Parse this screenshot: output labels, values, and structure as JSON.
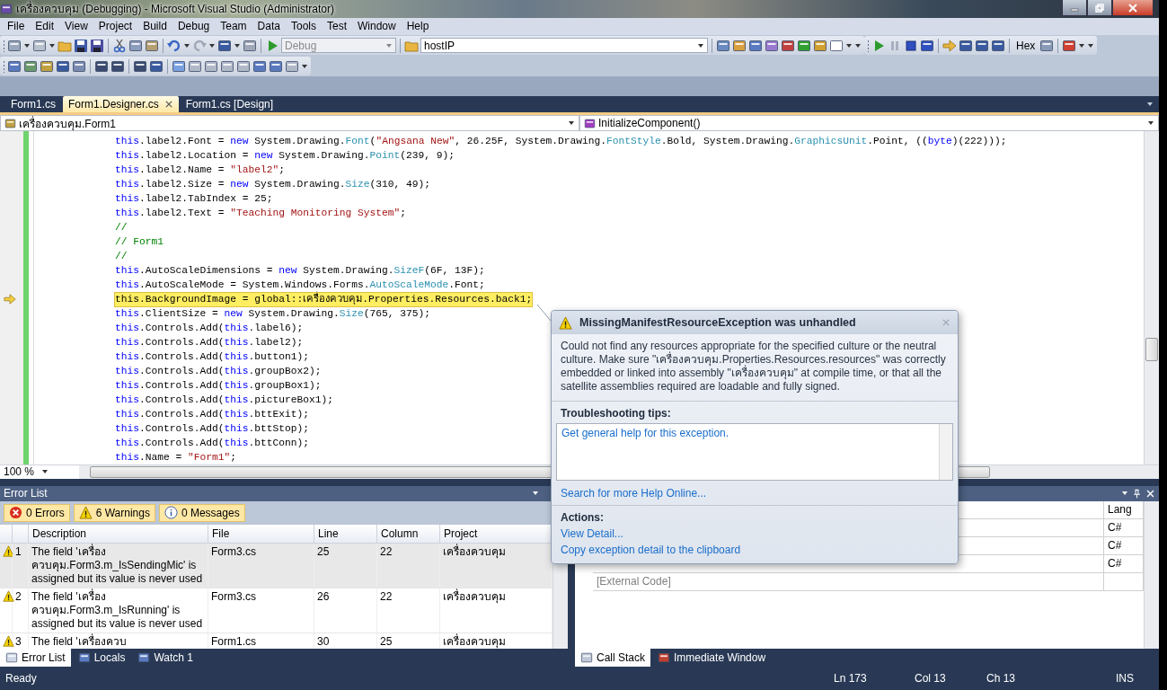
{
  "window": {
    "title": "เครื่องควบคุม (Debugging) - Microsoft Visual Studio (Administrator)"
  },
  "menu": [
    "File",
    "Edit",
    "View",
    "Project",
    "Build",
    "Debug",
    "Team",
    "Data",
    "Tools",
    "Test",
    "Window",
    "Help"
  ],
  "toolbar": {
    "configuration": {
      "value": "Debug",
      "disabled": true
    },
    "find": {
      "value": "hostIP"
    },
    "hex_button": {
      "label": "Hex"
    }
  },
  "document_tabs": [
    {
      "label": "Form1.cs",
      "selected": false,
      "closable": false
    },
    {
      "label": "Form1.Designer.cs",
      "selected": true,
      "closable": true
    },
    {
      "label": "Form1.cs [Design]",
      "selected": false,
      "closable": false
    }
  ],
  "navigation": {
    "type_dropdown": "เครื่องควบคุม.Form1",
    "member_dropdown": "InitializeComponent()"
  },
  "editor": {
    "zoom": "100 %",
    "lines": [
      {
        "current": false,
        "segments": [
          {
            "kind": "keyword",
            "text": "this"
          },
          {
            "kind": "plain",
            "text": ".label2.Font = "
          },
          {
            "kind": "keyword",
            "text": "new"
          },
          {
            "kind": "plain",
            "text": " System.Drawing."
          },
          {
            "kind": "type",
            "text": "Font"
          },
          {
            "kind": "plain",
            "text": "("
          },
          {
            "kind": "string",
            "text": "\"Angsana New\""
          },
          {
            "kind": "plain",
            "text": ", 26.25F, System.Drawing."
          },
          {
            "kind": "type",
            "text": "FontStyle"
          },
          {
            "kind": "plain",
            "text": ".Bold, System.Drawing."
          },
          {
            "kind": "type",
            "text": "GraphicsUnit"
          },
          {
            "kind": "plain",
            "text": ".Point, (("
          },
          {
            "kind": "keyword",
            "text": "byte"
          },
          {
            "kind": "plain",
            "text": ")(222)));"
          }
        ]
      },
      {
        "current": false,
        "segments": [
          {
            "kind": "keyword",
            "text": "this"
          },
          {
            "kind": "plain",
            "text": ".label2.Location = "
          },
          {
            "kind": "keyword",
            "text": "new"
          },
          {
            "kind": "plain",
            "text": " System.Drawing."
          },
          {
            "kind": "type",
            "text": "Point"
          },
          {
            "kind": "plain",
            "text": "(239, 9);"
          }
        ]
      },
      {
        "current": false,
        "segments": [
          {
            "kind": "keyword",
            "text": "this"
          },
          {
            "kind": "plain",
            "text": ".label2.Name = "
          },
          {
            "kind": "string",
            "text": "\"label2\""
          },
          {
            "kind": "plain",
            "text": ";"
          }
        ]
      },
      {
        "current": false,
        "segments": [
          {
            "kind": "keyword",
            "text": "this"
          },
          {
            "kind": "plain",
            "text": ".label2.Size = "
          },
          {
            "kind": "keyword",
            "text": "new"
          },
          {
            "kind": "plain",
            "text": " System.Drawing."
          },
          {
            "kind": "type",
            "text": "Size"
          },
          {
            "kind": "plain",
            "text": "(310, 49);"
          }
        ]
      },
      {
        "current": false,
        "segments": [
          {
            "kind": "keyword",
            "text": "this"
          },
          {
            "kind": "plain",
            "text": ".label2.TabIndex = 25;"
          }
        ]
      },
      {
        "current": false,
        "segments": [
          {
            "kind": "keyword",
            "text": "this"
          },
          {
            "kind": "plain",
            "text": ".label2.Text = "
          },
          {
            "kind": "string",
            "text": "\"Teaching Monitoring System\""
          },
          {
            "kind": "plain",
            "text": ";"
          }
        ]
      },
      {
        "current": false,
        "segments": [
          {
            "kind": "comment",
            "text": "//"
          }
        ]
      },
      {
        "current": false,
        "segments": [
          {
            "kind": "comment",
            "text": "// Form1"
          }
        ]
      },
      {
        "current": false,
        "segments": [
          {
            "kind": "comment",
            "text": "//"
          }
        ]
      },
      {
        "current": false,
        "segments": [
          {
            "kind": "keyword",
            "text": "this"
          },
          {
            "kind": "plain",
            "text": ".AutoScaleDimensions = "
          },
          {
            "kind": "keyword",
            "text": "new"
          },
          {
            "kind": "plain",
            "text": " System.Drawing."
          },
          {
            "kind": "type",
            "text": "SizeF"
          },
          {
            "kind": "plain",
            "text": "(6F, 13F);"
          }
        ]
      },
      {
        "current": false,
        "segments": [
          {
            "kind": "keyword",
            "text": "this"
          },
          {
            "kind": "plain",
            "text": ".AutoScaleMode = System.Windows.Forms."
          },
          {
            "kind": "type",
            "text": "AutoScaleMode"
          },
          {
            "kind": "plain",
            "text": ".Font;"
          }
        ]
      },
      {
        "current": true,
        "segments": [
          {
            "kind": "plain",
            "text": "this.BackgroundImage = global::เครื่องควบคุม.Properties.Resources.back1;"
          }
        ]
      },
      {
        "current": false,
        "segments": [
          {
            "kind": "keyword",
            "text": "this"
          },
          {
            "kind": "plain",
            "text": ".ClientSize = "
          },
          {
            "kind": "keyword",
            "text": "new"
          },
          {
            "kind": "plain",
            "text": " System.Drawing."
          },
          {
            "kind": "type",
            "text": "Size"
          },
          {
            "kind": "plain",
            "text": "(765, 375);"
          }
        ]
      },
      {
        "current": false,
        "segments": [
          {
            "kind": "keyword",
            "text": "this"
          },
          {
            "kind": "plain",
            "text": ".Controls.Add("
          },
          {
            "kind": "keyword",
            "text": "this"
          },
          {
            "kind": "plain",
            "text": ".label6);"
          }
        ]
      },
      {
        "current": false,
        "segments": [
          {
            "kind": "keyword",
            "text": "this"
          },
          {
            "kind": "plain",
            "text": ".Controls.Add("
          },
          {
            "kind": "keyword",
            "text": "this"
          },
          {
            "kind": "plain",
            "text": ".label2);"
          }
        ]
      },
      {
        "current": false,
        "segments": [
          {
            "kind": "keyword",
            "text": "this"
          },
          {
            "kind": "plain",
            "text": ".Controls.Add("
          },
          {
            "kind": "keyword",
            "text": "this"
          },
          {
            "kind": "plain",
            "text": ".button1);"
          }
        ]
      },
      {
        "current": false,
        "segments": [
          {
            "kind": "keyword",
            "text": "this"
          },
          {
            "kind": "plain",
            "text": ".Controls.Add("
          },
          {
            "kind": "keyword",
            "text": "this"
          },
          {
            "kind": "plain",
            "text": ".groupBox2);"
          }
        ]
      },
      {
        "current": false,
        "segments": [
          {
            "kind": "keyword",
            "text": "this"
          },
          {
            "kind": "plain",
            "text": ".Controls.Add("
          },
          {
            "kind": "keyword",
            "text": "this"
          },
          {
            "kind": "plain",
            "text": ".groupBox1);"
          }
        ]
      },
      {
        "current": false,
        "segments": [
          {
            "kind": "keyword",
            "text": "this"
          },
          {
            "kind": "plain",
            "text": ".Controls.Add("
          },
          {
            "kind": "keyword",
            "text": "this"
          },
          {
            "kind": "plain",
            "text": ".pictureBox1);"
          }
        ]
      },
      {
        "current": false,
        "segments": [
          {
            "kind": "keyword",
            "text": "this"
          },
          {
            "kind": "plain",
            "text": ".Controls.Add("
          },
          {
            "kind": "keyword",
            "text": "this"
          },
          {
            "kind": "plain",
            "text": ".bttExit);"
          }
        ]
      },
      {
        "current": false,
        "segments": [
          {
            "kind": "keyword",
            "text": "this"
          },
          {
            "kind": "plain",
            "text": ".Controls.Add("
          },
          {
            "kind": "keyword",
            "text": "this"
          },
          {
            "kind": "plain",
            "text": ".bttStop);"
          }
        ]
      },
      {
        "current": false,
        "segments": [
          {
            "kind": "keyword",
            "text": "this"
          },
          {
            "kind": "plain",
            "text": ".Controls.Add("
          },
          {
            "kind": "keyword",
            "text": "this"
          },
          {
            "kind": "plain",
            "text": ".bttConn);"
          }
        ]
      },
      {
        "current": false,
        "segments": [
          {
            "kind": "keyword",
            "text": "this"
          },
          {
            "kind": "plain",
            "text": ".Name = "
          },
          {
            "kind": "string",
            "text": "\"Form1\""
          },
          {
            "kind": "plain",
            "text": ";"
          }
        ]
      }
    ]
  },
  "exception": {
    "title": "MissingManifestResourceException was unhandled",
    "message": "Could not find any resources appropriate for the specified culture or the neutral culture.  Make sure \"เครื่องควบคุม.Properties.Resources.resources\" was correctly embedded or linked into assembly \"เครื่องควบคุม\" at compile time, or that all the satellite assemblies required are loadable and fully signed.",
    "tips_heading": "Troubleshooting tips:",
    "tips": [
      "Get general help for this exception."
    ],
    "help_link": "Search for more Help Online...",
    "actions_heading": "Actions:",
    "actions": [
      "View Detail...",
      "Copy exception detail to the clipboard"
    ]
  },
  "error_list": {
    "title": "Error List",
    "filters": [
      {
        "kind": "error",
        "label": "0 Errors",
        "selected": true
      },
      {
        "kind": "warning",
        "label": "6 Warnings",
        "selected": true
      },
      {
        "kind": "message",
        "label": "0 Messages",
        "selected": true
      }
    ],
    "columns": [
      "Description",
      "File",
      "Line",
      "Column",
      "Project"
    ],
    "rows": [
      {
        "kind": "warning",
        "number": "1",
        "description": "The field 'เครื่องควบคุม.Form3.m_IsSendingMic' is assigned but its value is never used",
        "file": "Form3.cs",
        "line": "25",
        "column": "22",
        "project": "เครื่องควบคุม",
        "selected": true
      },
      {
        "kind": "warning",
        "number": "2",
        "description": "The field 'เครื่องควบคุม.Form3.m_IsRunning' is assigned but its value is never used",
        "file": "Form3.cs",
        "line": "26",
        "column": "22",
        "project": "เครื่องควบคุม",
        "selected": false
      },
      {
        "kind": "warning",
        "number": "3",
        "description": "The field 'เครื่องควบ",
        "file": "Form1.cs",
        "line": "30",
        "column": "25",
        "project": "เครื่องควบคุม",
        "selected": false
      }
    ]
  },
  "call_stack": {
    "columns": [
      "Lang"
    ],
    "rows": [
      {
        "lang": "C#"
      },
      {
        "lang": "C#"
      },
      {
        "lang": "C#"
      },
      {
        "name": "[External Code]"
      }
    ]
  },
  "bottom_tabs_left": [
    {
      "label": "Error List",
      "selected": true
    },
    {
      "label": "Locals",
      "selected": false
    },
    {
      "label": "Watch 1",
      "selected": false
    }
  ],
  "bottom_tabs_right": [
    {
      "label": "Call Stack",
      "selected": true
    },
    {
      "label": "Immediate Window",
      "selected": false
    }
  ],
  "status_bar": {
    "message": "Ready",
    "line": "Ln 173",
    "column": "Col 13",
    "char": "Ch 13",
    "mode": "INS"
  }
}
